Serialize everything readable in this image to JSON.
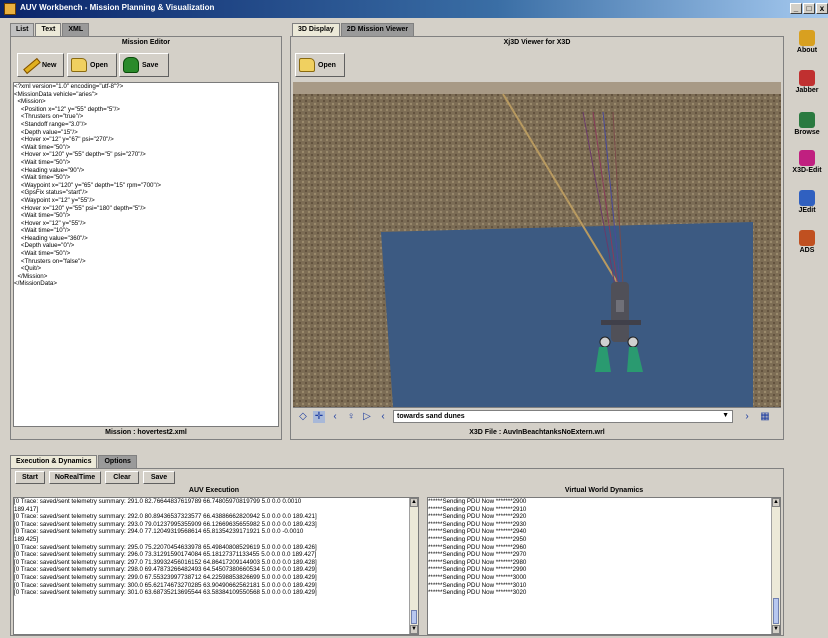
{
  "window": {
    "title": "AUV Workbench - Mission Planning & Visualization",
    "min": "_",
    "max": "□",
    "close": "x"
  },
  "left_panel": {
    "tabs": [
      "List",
      "Text",
      "XML"
    ],
    "title": "Mission Editor",
    "new_label": "New",
    "open_label": "Open",
    "save_label": "Save",
    "footer": "Mission : hovertest2.xml",
    "xml_lines": [
      "<?xml version=\"1.0\" encoding=\"utf-8\"?>",
      "<MissionData vehicle=\"aries\">",
      "  <Mission>",
      "    <Position x=\"12\" y=\"55\" depth=\"5\"/>",
      "    <Thrusters on=\"true\"/>",
      "    <Standoff range=\"3.0\"/>",
      "    <Depth value=\"15\"/>",
      "    <Hover x=\"12\" y=\"67\" psi=\"270\"/>",
      "    <Wait time=\"50\"/>",
      "    <Hover x=\"120\" y=\"55\" depth=\"5\" psi=\"270\"/>",
      "    <Wait time=\"50\"/>",
      "    <Heading value=\"90\"/>",
      "    <Wait time=\"50\"/>",
      "    <Waypoint x=\"120\" y=\"65\" depth=\"15\" rpm=\"700\"/>",
      "    <GpsFix status=\"start\"/>",
      "    <Waypoint x=\"12\" y=\"55\"/>",
      "    <Hover x=\"120\" y=\"55\" psi=\"180\" depth=\"5\"/>",
      "    <Wait time=\"50\"/>",
      "    <Hover x=\"12\" y=\"55\"/>",
      "    <Wait time=\"10\"/>",
      "    <Heading value=\"360\"/>",
      "    <Depth value=\"0\"/>",
      "    <Wait time=\"50\"/>",
      "    <Thrusters on=\"false\"/>",
      "    <Quit/>",
      "  </Mission>",
      "</MissionData>"
    ]
  },
  "right_panel": {
    "tabs": [
      "3D Display",
      "2D Mission Viewer"
    ],
    "title": "Xj3D Viewer for X3D",
    "open_label": "Open",
    "viewpoint": "towards sand dunes",
    "footer": "X3D File : AuvInBeachtanksNoExtern.wrl"
  },
  "sidebar": {
    "items": [
      {
        "label": "About",
        "icon": "info-icon",
        "color": "#d8a020"
      },
      {
        "label": "Jabber",
        "icon": "chat-icon",
        "color": "#c03030"
      },
      {
        "label": "Browse",
        "icon": "globe-icon",
        "color": "#2a7a40"
      },
      {
        "label": "X3D-Edit",
        "icon": "shapes-icon",
        "color": "#c02080"
      },
      {
        "label": "JEdit",
        "icon": "editor-icon",
        "color": "#3060c0"
      },
      {
        "label": "ADS",
        "icon": "people-icon",
        "color": "#c05020"
      }
    ]
  },
  "bottom": {
    "tabs": [
      "Execution & Dynamics",
      "Options"
    ],
    "buttons": [
      "Start",
      "NoRealTime",
      "Clear",
      "Save"
    ],
    "auv_title": "AUV Execution",
    "vw_title": "Virtual World Dynamics",
    "auv_lines": [
      "[0 Trace: saved/sent telemetry summary: 291.0 82.76644837619789 66.74805970819799 5.0 0.0 0.0010",
      "189.417]",
      "[0 Trace: saved/sent telemetry summary: 292.0 80.89436537323577 66.43886662820942 5.0 0.0 0.0 189.421]",
      "[0 Trace: saved/sent telemetry summary: 293.0 79.01237995355909 66.12669635655982 5.0 0.0 0.0 189.423]",
      "[0 Trace: saved/sent telemetry summary: 294.0 77.12049319568614 65.81354239171921 5.0 0.0 -0.0010",
      "189.425]",
      "[0 Trace: saved/sent telemetry summary: 295.0 75.22070454633978 65.49840808529619 5.0 0.0 0.0 189.426]",
      "[0 Trace: saved/sent telemetry summary: 296.0 73.31291590174084 65.18127371133455 5.0 0.0 0.0 189.427]",
      "[0 Trace: saved/sent telemetry summary: 297.0 71.39932456016152 64.86417209144903 5.0 0.0 0.0 189.428]",
      "[0 Trace: saved/sent telemetry summary: 298.0 69.47873266482493 64.54507380660534 5.0 0.0 0.0 189.429]",
      "[0 Trace: saved/sent telemetry summary: 299.0 67.55323997738712 64.22598853826699 5.0 0.0 0.0 189.429]",
      "[0 Trace: saved/sent telemetry summary: 300.0 65.62174673270285 63.90490662562181 5.0 0.0 0.0 189.429]",
      "[0 Trace: saved/sent telemetry summary: 301.0 63.68735213695544 63.58384109550568 5.0 0.0 0.0 189.429]"
    ],
    "vw_lines": [
      "******Sending PDU Now *******2900",
      "******Sending PDU Now *******2910",
      "******Sending PDU Now *******2920",
      "******Sending PDU Now *******2930",
      "******Sending PDU Now *******2940",
      "******Sending PDU Now *******2950",
      "******Sending PDU Now *******2960",
      "******Sending PDU Now *******2970",
      "******Sending PDU Now *******2980",
      "******Sending PDU Now *******2990",
      "******Sending PDU Now *******3000",
      "******Sending PDU Now *******3010",
      "******Sending PDU Now *******3020"
    ]
  },
  "colors": {
    "water": "#3c5a82",
    "wall": "#7a6a52",
    "vehicle": "#505058"
  }
}
